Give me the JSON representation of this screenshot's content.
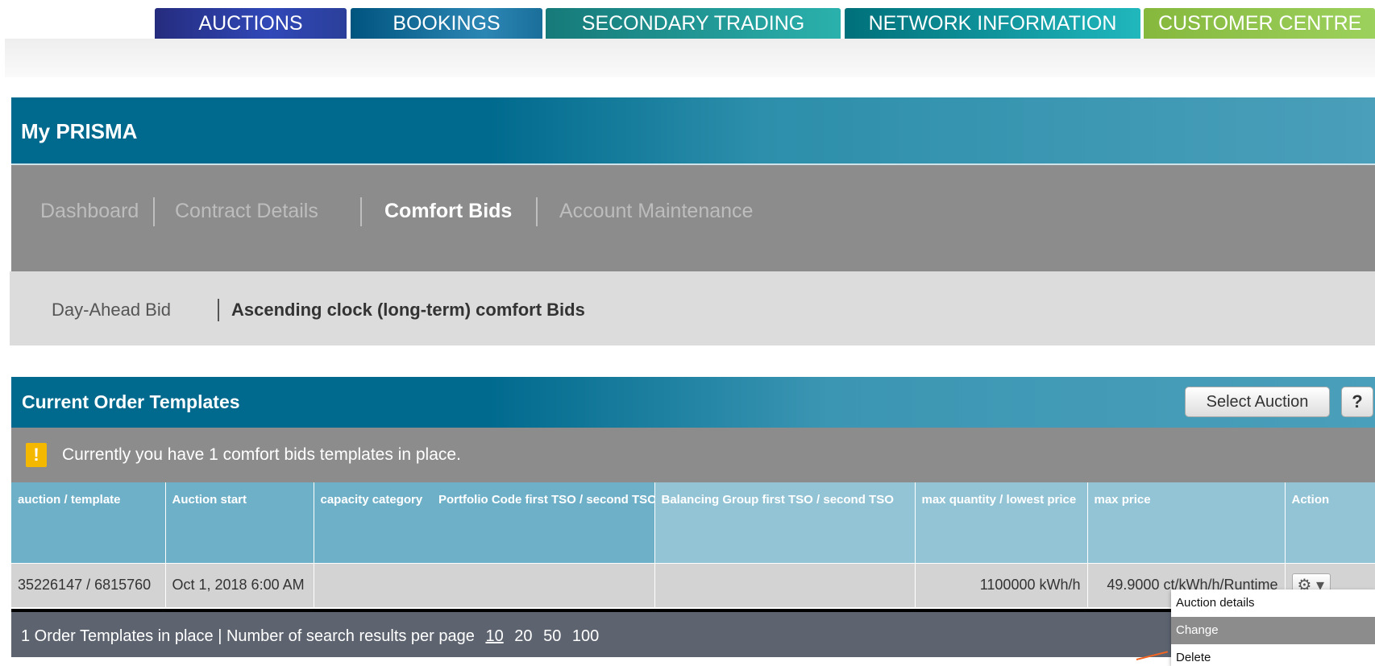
{
  "nav": {
    "tabs": [
      {
        "label": "AUCTIONS"
      },
      {
        "label": "BOOKINGS"
      },
      {
        "label": "SECONDARY TRADING"
      },
      {
        "label": "NETWORK INFORMATION"
      },
      {
        "label": "CUSTOMER CENTRE"
      }
    ]
  },
  "header": {
    "title": "My PRISMA"
  },
  "main_menu": {
    "items": [
      {
        "label": "Dashboard"
      },
      {
        "label": "Contract Details"
      },
      {
        "label": "Comfort Bids",
        "active": true
      },
      {
        "label": "Account Maintenance"
      }
    ]
  },
  "sub_menu": {
    "items": [
      {
        "label": "Day-Ahead Bid"
      },
      {
        "label": "Ascending clock (long-term) comfort Bids",
        "active": true
      }
    ]
  },
  "panel": {
    "title": "Current Order Templates",
    "select_auction_label": "Select Auction",
    "help_label": "?",
    "info_icon": "!",
    "info_text": "Currently you have 1 comfort bids templates in place."
  },
  "table": {
    "columns": [
      "auction / template",
      "Auction start",
      "capacity category",
      "Portfolio Code first TSO / second TSO",
      "Balancing Group first TSO / second TSO",
      "max quantity / lowest price",
      "max price",
      "Action"
    ],
    "rows": [
      {
        "auction_template": "35226147 / 6815760",
        "auction_start": "Oct 1, 2018 6:00 AM",
        "capacity_category": "",
        "portfolio_code": "",
        "balancing_group": "",
        "max_quantity": "1100000 kWh/h",
        "max_price": "49.9000 ct/kWh/h/Runtime",
        "action_icon": "gear-icon"
      }
    ]
  },
  "footer": {
    "summary": "1 Order Templates in place | Number of search results per page",
    "page_sizes": [
      "10",
      "20",
      "50",
      "100"
    ],
    "current_page_size": "10"
  },
  "action_menu": {
    "items": [
      {
        "label": "Auction details"
      },
      {
        "label": "Change",
        "highlighted": true
      },
      {
        "label": "Delete"
      }
    ]
  },
  "colors": {
    "tab_auctions": "#2b3f9a",
    "tab_bookings": "#1a6f9a",
    "tab_secondary": "#2bb1ad",
    "tab_network": "#20b7bd",
    "tab_customer": "#9cd15d",
    "header_teal": "#006a8e",
    "menu_grey": "#8c8c8c",
    "warning_yellow": "#f5b800"
  }
}
